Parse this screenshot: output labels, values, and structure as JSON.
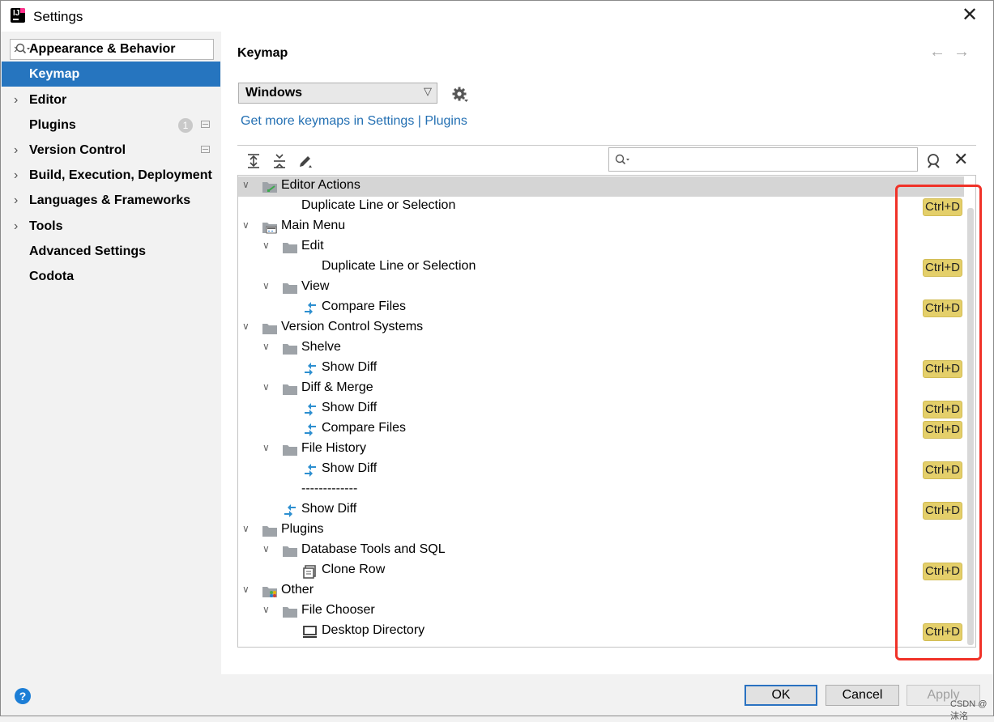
{
  "window": {
    "title": "Settings"
  },
  "sidebar": {
    "search_placeholder": "",
    "items": [
      {
        "label": "Appearance & Behavior",
        "expandable": true
      },
      {
        "label": "Keymap",
        "expandable": false,
        "selected": true
      },
      {
        "label": "Editor",
        "expandable": true
      },
      {
        "label": "Plugins",
        "expandable": false,
        "badge": "1"
      },
      {
        "label": "Version Control",
        "expandable": true
      },
      {
        "label": "Build, Execution, Deployment",
        "expandable": true
      },
      {
        "label": "Languages & Frameworks",
        "expandable": true
      },
      {
        "label": "Tools",
        "expandable": true
      },
      {
        "label": "Advanced Settings",
        "expandable": false
      },
      {
        "label": "Codota",
        "expandable": false
      }
    ]
  },
  "main": {
    "title": "Keymap",
    "keymap_value": "Windows",
    "link": "Get more keymaps in Settings | Plugins",
    "tree": [
      {
        "label": "Editor Actions",
        "level": 0,
        "icon": "editor-actions-icon",
        "expanded": true
      },
      {
        "label": "Duplicate Line or Selection",
        "level": 1,
        "icon": "",
        "shortcut": "Ctrl+D"
      },
      {
        "label": "Main Menu",
        "level": 0,
        "icon": "main-menu-icon",
        "expanded": true
      },
      {
        "label": "Edit",
        "level": 1,
        "icon": "folder-icon",
        "expanded": true
      },
      {
        "label": "Duplicate Line or Selection",
        "level": 2,
        "icon": "",
        "shortcut": "Ctrl+D"
      },
      {
        "label": "View",
        "level": 1,
        "icon": "folder-icon",
        "expanded": true
      },
      {
        "label": "Compare Files",
        "level": 2,
        "icon": "diff-icon",
        "shortcut": "Ctrl+D"
      },
      {
        "label": "Version Control Systems",
        "level": 0,
        "icon": "folder-icon",
        "expanded": true
      },
      {
        "label": "Shelve",
        "level": 1,
        "icon": "folder-icon",
        "expanded": true
      },
      {
        "label": "Show Diff",
        "level": 2,
        "icon": "diff-icon",
        "shortcut": "Ctrl+D"
      },
      {
        "label": "Diff & Merge",
        "level": 1,
        "icon": "folder-icon",
        "expanded": true
      },
      {
        "label": "Show Diff",
        "level": 2,
        "icon": "diff-icon",
        "shortcut": "Ctrl+D"
      },
      {
        "label": "Compare Files",
        "level": 2,
        "icon": "diff-icon",
        "shortcut": "Ctrl+D"
      },
      {
        "label": "File History",
        "level": 1,
        "icon": "folder-icon",
        "expanded": true
      },
      {
        "label": "Show Diff",
        "level": 2,
        "icon": "diff-icon",
        "shortcut": "Ctrl+D"
      },
      {
        "label": "-------------",
        "level": 1,
        "icon": ""
      },
      {
        "label": "Show Diff",
        "level": 1,
        "icon": "diff-icon",
        "shortcut": "Ctrl+D"
      },
      {
        "label": "Plugins",
        "level": 0,
        "icon": "folder-icon",
        "expanded": true
      },
      {
        "label": "Database Tools and SQL",
        "level": 1,
        "icon": "folder-icon",
        "expanded": true
      },
      {
        "label": "Clone Row",
        "level": 2,
        "icon": "clone-icon",
        "shortcut": "Ctrl+D"
      },
      {
        "label": "Other",
        "level": 0,
        "icon": "other-icon",
        "expanded": true
      },
      {
        "label": "File Chooser",
        "level": 1,
        "icon": "folder-icon",
        "expanded": true
      },
      {
        "label": "Desktop Directory",
        "level": 2,
        "icon": "desktop-icon",
        "shortcut": "Ctrl+D"
      }
    ]
  },
  "buttons": {
    "ok": "OK",
    "cancel": "Cancel",
    "apply": "Apply"
  },
  "watermark": "CSDN @沫洺",
  "colors": {
    "selection": "#2675bf",
    "shortcut_bg": "#e4cf6a",
    "link": "#2470b3",
    "highlight_box": "#f03228"
  }
}
